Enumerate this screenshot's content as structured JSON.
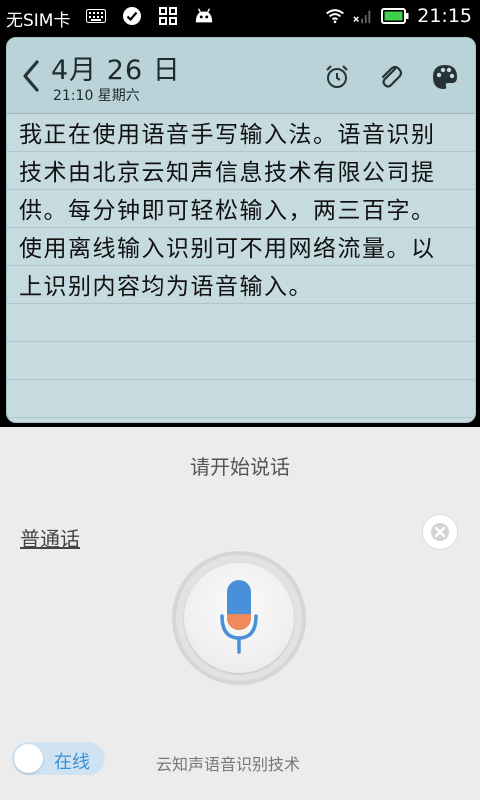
{
  "status_bar": {
    "carrier": "无SIM卡",
    "time": "21:15",
    "icons": [
      "keyboard-icon",
      "check-circle-icon",
      "apps-grid-icon",
      "android-icon",
      "wifi-icon",
      "signal-x-icon",
      "battery-icon"
    ]
  },
  "note": {
    "date": "4月 26 日",
    "time_weekday": "21:10 星期六",
    "header_icons": [
      "alarm-clock-icon",
      "paperclip-icon",
      "palette-icon"
    ],
    "text": "我正在使用语音手写输入法。语音识别技术由北京云知声信息技术有限公司提供。每分钟即可轻松输入，两三百字。使用离线输入识别可不用网络流量。以上识别内容均为语音输入。"
  },
  "voice_panel": {
    "prompt": "请开始说话",
    "language": "普通话",
    "mode_toggle_label": "在线",
    "footer_text": "云知声语音识别技术"
  },
  "colors": {
    "note_bg": "#c6dbe0",
    "note_header_bg": "#b9d3d8",
    "panel_bg": "#ececec",
    "mic_blue": "#4a90d9",
    "mic_orange": "#f08a5d",
    "toggle_blue": "#3b8fd2"
  }
}
